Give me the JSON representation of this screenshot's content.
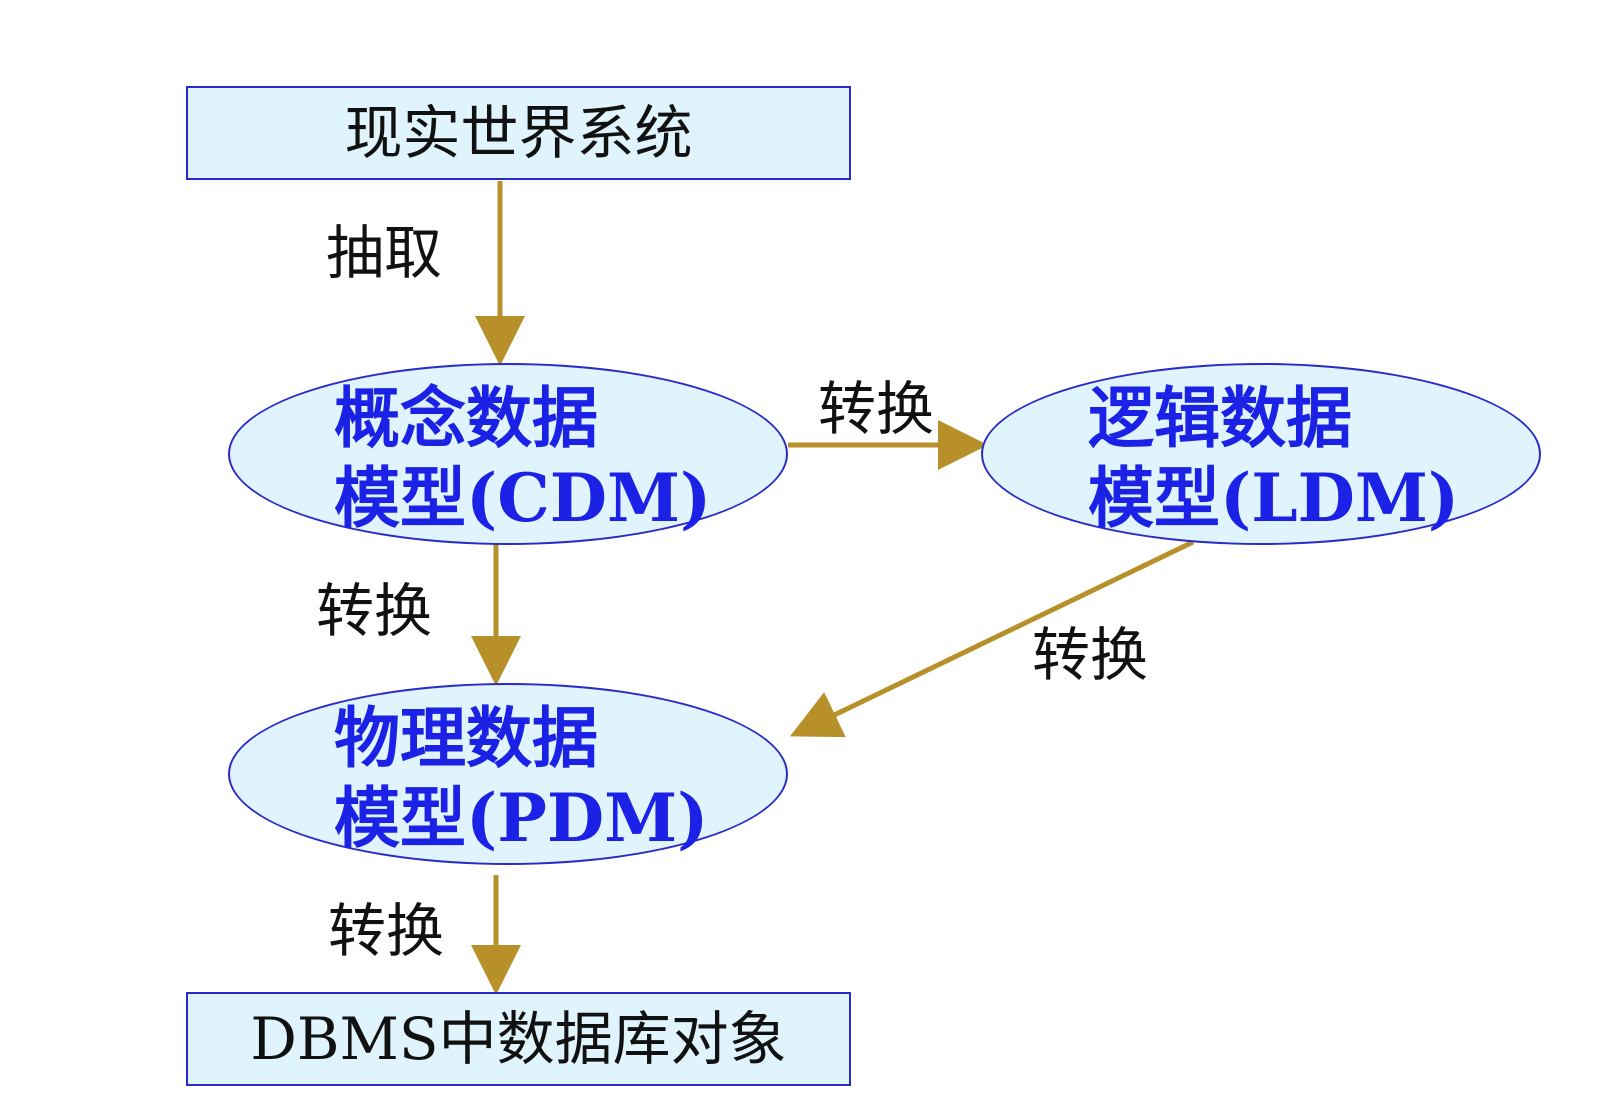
{
  "nodes": {
    "real_world": {
      "label": "现实世界系统"
    },
    "cdm": {
      "line1": "概念数据",
      "line2": "模型(CDM)"
    },
    "ldm": {
      "line1": "逻辑数据",
      "line2": "模型(LDM)"
    },
    "pdm": {
      "line1": "物理数据",
      "line2": "模型(PDM)"
    },
    "dbms": {
      "label": "DBMS中数据库对象"
    }
  },
  "edges": {
    "real_to_cdm": {
      "label": "抽取"
    },
    "cdm_to_ldm": {
      "label": "转换"
    },
    "cdm_to_pdm": {
      "label": "转换"
    },
    "ldm_to_pdm": {
      "label": "转换"
    },
    "pdm_to_dbms": {
      "label": "转换"
    }
  },
  "colors": {
    "node_fill": "#dff4fc",
    "node_border": "#2a2ac8",
    "model_text": "#1b22e6",
    "arrow": "#b8902a",
    "plain_text": "#111111"
  }
}
